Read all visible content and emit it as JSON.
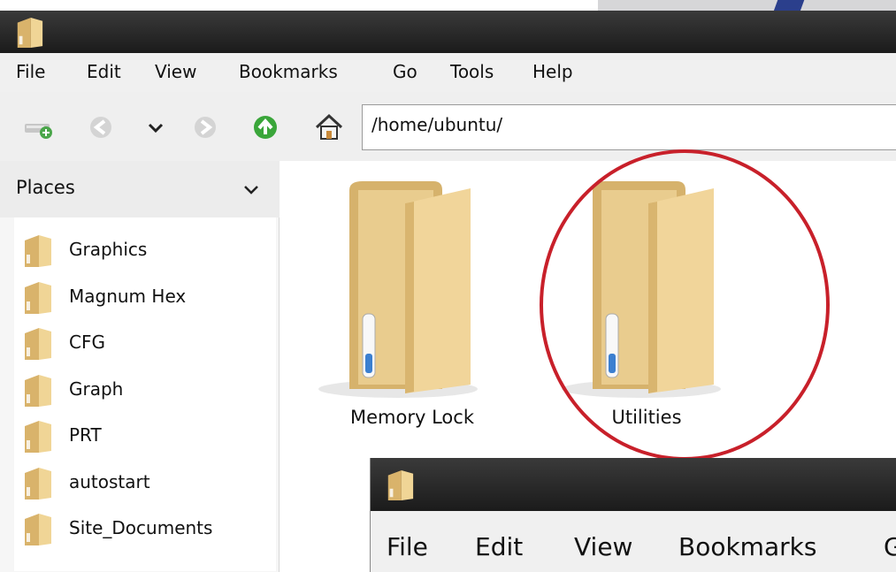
{
  "menubar": {
    "items": [
      {
        "label": "File"
      },
      {
        "label": "Edit"
      },
      {
        "label": "View"
      },
      {
        "label": "Bookmarks"
      },
      {
        "label": "Go"
      },
      {
        "label": "Tools"
      },
      {
        "label": "Help"
      }
    ]
  },
  "toolbar": {
    "address": "/home/ubuntu/",
    "icons": [
      "new-tab-icon",
      "back-icon",
      "history-dropdown-icon",
      "forward-icon",
      "parent-folder-icon",
      "home-icon"
    ]
  },
  "sidebar": {
    "title": "Places",
    "items": [
      {
        "label": "Graphics"
      },
      {
        "label": "Magnum Hex"
      },
      {
        "label": "CFG"
      },
      {
        "label": "Graph"
      },
      {
        "label": "PRT"
      },
      {
        "label": "autostart"
      },
      {
        "label": "Site_Documents"
      }
    ]
  },
  "main": {
    "folders": [
      {
        "label": "Memory Lock"
      },
      {
        "label": "Utilities"
      }
    ]
  },
  "second_window": {
    "menu": [
      {
        "label": "File"
      },
      {
        "label": "Edit"
      },
      {
        "label": "View"
      },
      {
        "label": "Bookmarks"
      },
      {
        "label": "G"
      }
    ]
  },
  "colors": {
    "highlight_circle": "#c8202a",
    "titlebar": "#1b1b1b",
    "folder": "#e7c98a"
  }
}
